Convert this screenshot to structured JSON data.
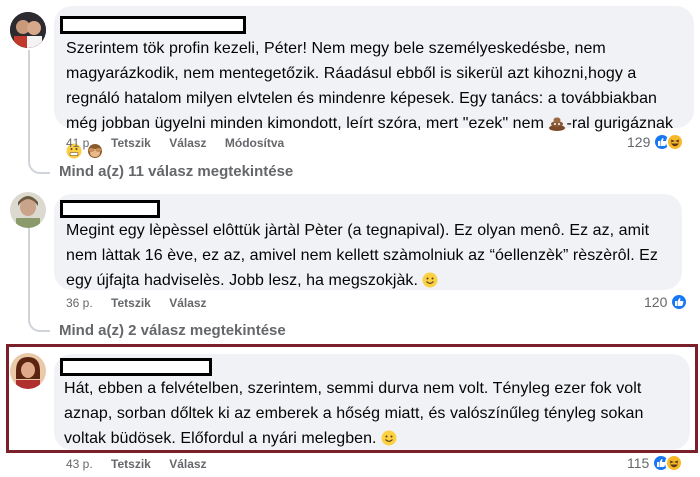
{
  "comments": [
    {
      "text": "Szerintem tök profin kezeli, Péter! Nem megy bele személyeskedésbe, nem magyarázkodik, nem mentegetőzik. Ráadásul ebből is sikerül azt kihozni,hogy a regnáló hatalom milyen elvtelen és mindenre képesek. Egy tanács: a továbbiakban még jobban ügyelni minden kimondott, leírt szóra, mert \"ezek\" nem",
      "text_tail": "-ral gurigáznak",
      "time": "41 p.",
      "like_label": "Tetszik",
      "reply_label": "Válasz",
      "edited_label": "Módosítva",
      "reaction_count": "129",
      "view_replies": "Mind a(z) 11 válasz megtekintése"
    },
    {
      "text": "Megint egy lèpèssel elôttük jàrtàl Pèter (a tegnapival). Ez olyan menô. Ez az, amit nem làttak 16 ève, ez az, amivel nem kellett szàmolniuk az “óellenzèk” rèszèrôl. Ez egy újfajta hadviselès. Jobb lesz, ha megszokjàk.",
      "time": "36 p.",
      "like_label": "Tetszik",
      "reply_label": "Válasz",
      "reaction_count": "120",
      "view_replies": "Mind a(z) 2 válasz megtekintése"
    },
    {
      "text": "Hát, ebben a felvételben, szerintem, semmi durva nem volt. Tényleg ezer fok volt aznap, sorban dőltek ki az emberek a hőség miatt, és valószínűleg tényleg sokan voltak büdösek. Előfordul a nyári melegben.",
      "time": "43 p.",
      "like_label": "Tetszik",
      "reply_label": "Válasz",
      "reaction_count": "115"
    }
  ],
  "colors": {
    "bubble": "#f0f2f5",
    "meta": "#65676b",
    "like": "#1877f2",
    "haha": "#f7b928",
    "highlight": "#7b1f2a"
  },
  "icons": [
    "like-reaction-icon",
    "haha-reaction-icon",
    "poop-emoji",
    "grimace-emoji",
    "see-no-evil-monkey-emoji",
    "smile-emoji"
  ]
}
